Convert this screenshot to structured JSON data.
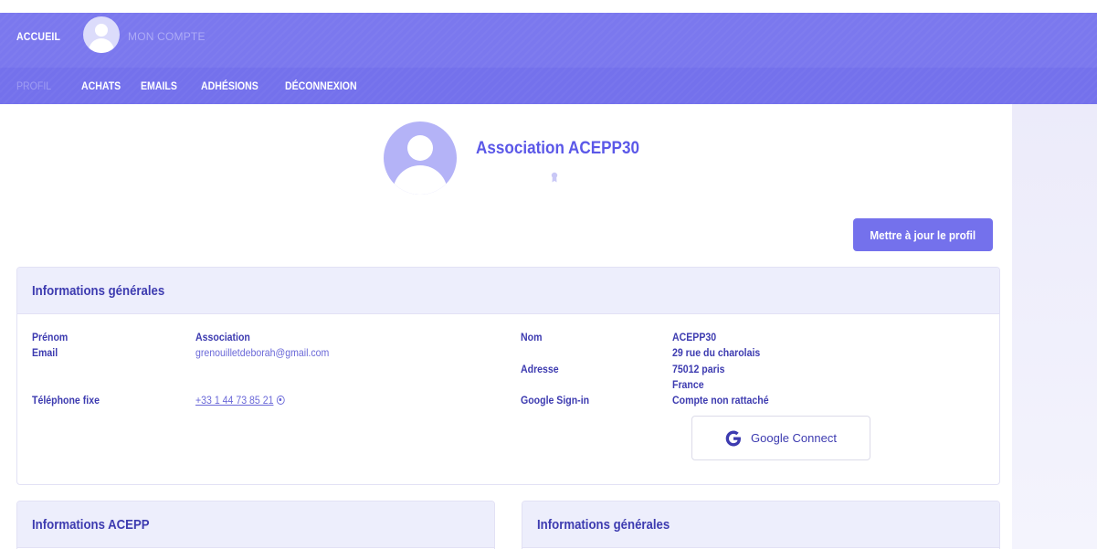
{
  "topbar": {
    "home_label": "ACCUEIL",
    "account_label": "MON COMPTE"
  },
  "subnav": {
    "items": [
      {
        "label": "PROFIL",
        "active": true
      },
      {
        "label": "ACHATS"
      },
      {
        "label": "EMAILS"
      },
      {
        "label": "ADHÉSIONS"
      },
      {
        "label": "DÉCONNEXION"
      }
    ]
  },
  "profile": {
    "name": "Association ACEPP30",
    "update_button": "Mettre à jour le profil"
  },
  "general_info": {
    "title": "Informations générales",
    "left": {
      "first_name_label": "Prénom",
      "first_name_value": "Association",
      "email_label": "Email",
      "email_value": "grenouilletdeborah@gmail.com",
      "phone_label": "Téléphone fixe",
      "phone_value": "+33 1 44 73 85 21"
    },
    "right": {
      "last_name_label": "Nom",
      "last_name_value": "ACEPP30",
      "address_label": "Adresse",
      "address_lines": [
        "29 rue du charolais",
        "75012 paris",
        "France"
      ],
      "google_label": "Google Sign-in",
      "google_value": "Compte non rattaché",
      "google_button": "Google Connect"
    }
  },
  "acepp_info": {
    "title": "Informations ACEPP"
  },
  "general_info_2": {
    "title": "Informations générales"
  },
  "colors": {
    "brand": "#7471ec",
    "text_dark": "#3d3bb0",
    "text_light": "#6a68d8",
    "card_header": "#edeefc"
  }
}
